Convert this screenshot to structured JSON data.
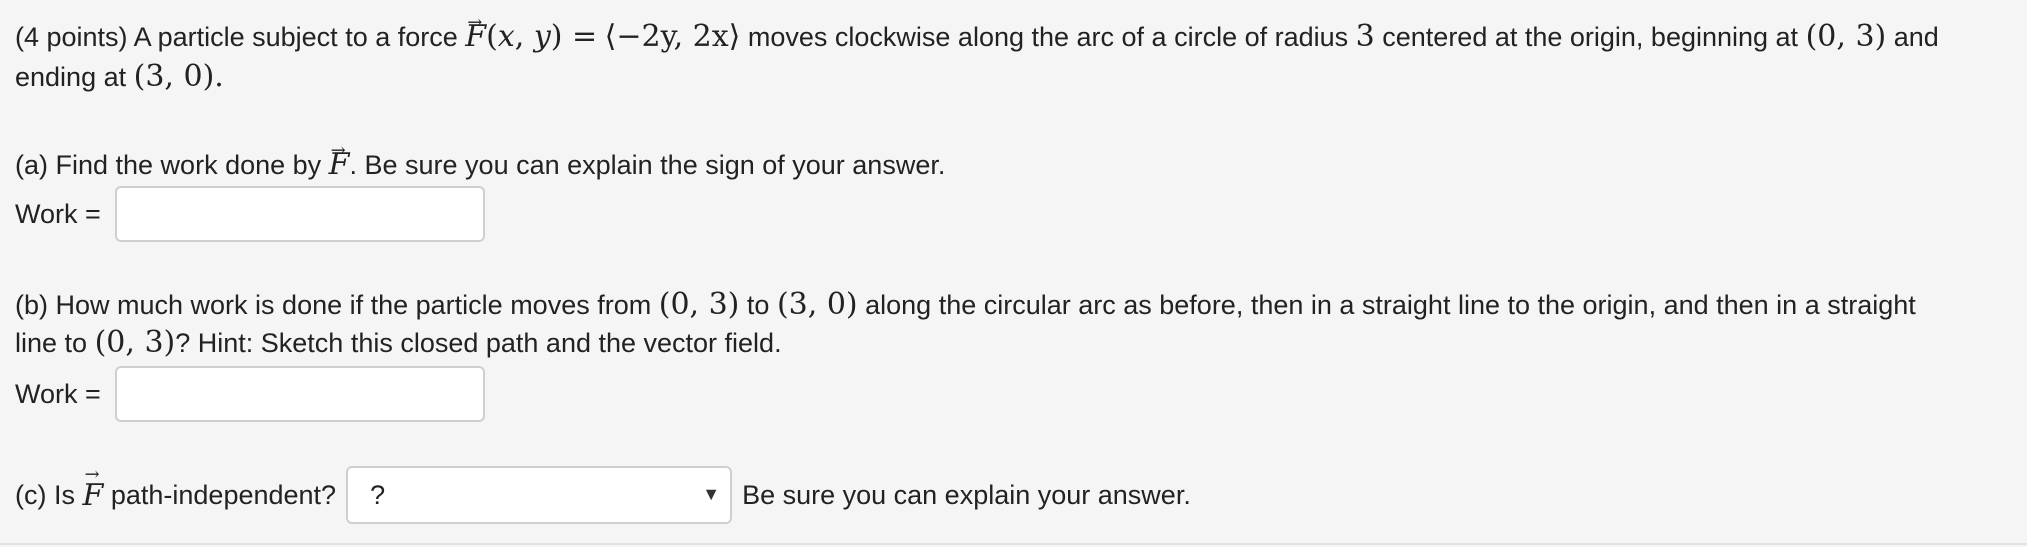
{
  "intro": {
    "points": "(4 points)",
    "text1": "A particle subject to a force",
    "force_lhs": "F(x, y) =",
    "force_rhs": "⟨−2y, 2x⟩",
    "text2": "moves clockwise along the arc of a circle of radius",
    "radius": "3",
    "text3": "centered at the origin, beginning at",
    "start_point": "(0, 3)",
    "text4": "and",
    "text5": "ending at",
    "end_point": "(3, 0)."
  },
  "part_a": {
    "prefix": "(a) Find the work done by",
    "vector": "F",
    "suffix": ". Be sure you can explain the sign of your answer.",
    "label": "Work =",
    "value": ""
  },
  "part_b": {
    "text1": "(b) How much work is done if the particle moves from",
    "p1": "(0, 3)",
    "to": "to",
    "p2": "(3, 0)",
    "text2": "along the circular arc as before, then in a straight line to the origin, and then in a straight",
    "text3": "line to",
    "p3": "(0, 3)",
    "text4": "? Hint: Sketch this closed path and the vector field.",
    "label": "Work =",
    "value": ""
  },
  "part_c": {
    "prefix": "(c) Is",
    "vector": "F",
    "question": "path-independent?",
    "selected": "?",
    "suffix": "Be sure you can explain your answer."
  }
}
